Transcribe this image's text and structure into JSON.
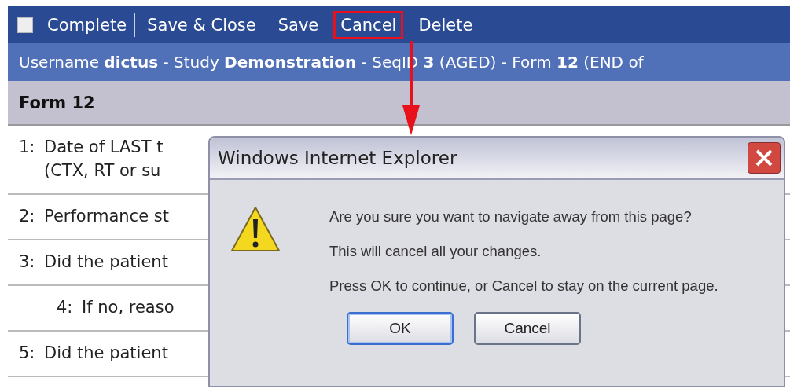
{
  "toolbar": {
    "complete": {
      "label": "Complete",
      "checked": false
    },
    "actions": [
      {
        "label": "Save & Close",
        "highlighted": false
      },
      {
        "label": "Save",
        "highlighted": false
      },
      {
        "label": "Cancel",
        "highlighted": true
      },
      {
        "label": "Delete",
        "highlighted": false
      }
    ]
  },
  "info_bar": "Username **dictus** - Study **Demonstration** - SeqID **3** (AGED) - Form **12** (END of",
  "form_header": "Form 12",
  "questions": [
    {
      "number": "1:",
      "lines": [
        "Date of LAST t",
        "(CTX, RT or su"
      ]
    },
    {
      "number": "2:",
      "lines": [
        "Performance st"
      ]
    },
    {
      "number": "3:",
      "lines": [
        "Did the patient"
      ],
      "children": [
        {
          "number": "4:",
          "lines": [
            "If no, reaso"
          ]
        }
      ]
    },
    {
      "number": "5:",
      "lines": [
        "Did the patient"
      ]
    }
  ],
  "dialog": {
    "title": "Windows Internet Explorer",
    "messages": [
      "Are you sure you want to navigate away from this page?",
      "This will cancel all your changes.",
      "Press OK to continue, or Cancel to stay on the current page."
    ],
    "buttons": [
      {
        "label": "OK",
        "default": true
      },
      {
        "label": "Cancel",
        "default": false
      }
    ]
  }
}
